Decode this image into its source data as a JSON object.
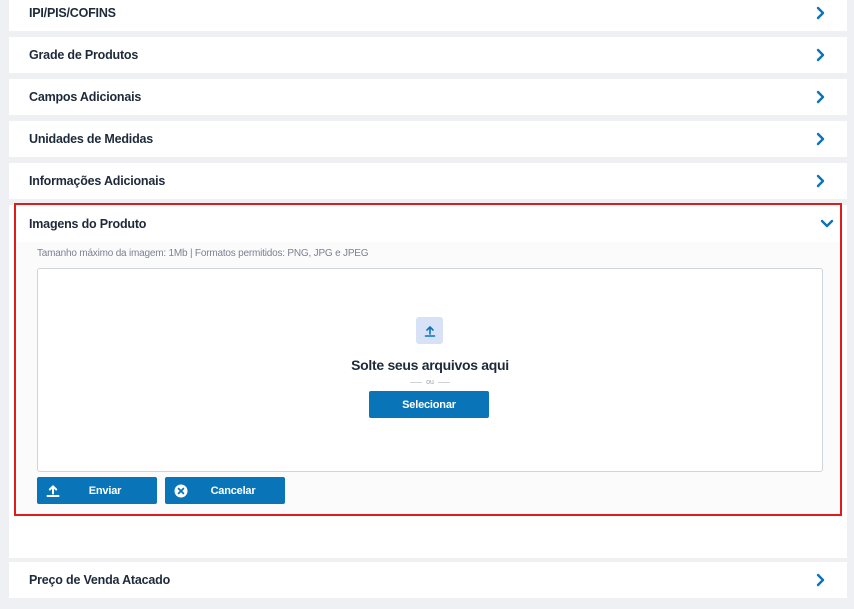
{
  "sections": {
    "ipi": "IPI/PIS/COFINS",
    "grade": "Grade de Produtos",
    "campos": "Campos Adicionais",
    "unidades": "Unidades de Medidas",
    "informacoes": "Informações Adicionais",
    "imagens": "Imagens do Produto",
    "preco_atacado": "Preço de Venda Atacado"
  },
  "upload": {
    "hint": "Tamanho máximo da imagem: 1Mb | Formatos permitidos: PNG, JPG e JPEG",
    "drop_title": "Solte seus arquivos aqui",
    "or_text": "ou",
    "select_label": "Selecionar",
    "send_label": "Enviar",
    "cancel_label": "Cancelar"
  },
  "icons": {
    "chevron_right": "chevron-right-icon",
    "chevron_down": "chevron-down-icon",
    "upload": "upload-icon",
    "cancel": "close-circle-icon"
  },
  "colors": {
    "accent": "#0a74b8",
    "highlight_border": "#e01b1b",
    "upload_tile": "#d8e2f7",
    "background": "#eef0f3"
  }
}
